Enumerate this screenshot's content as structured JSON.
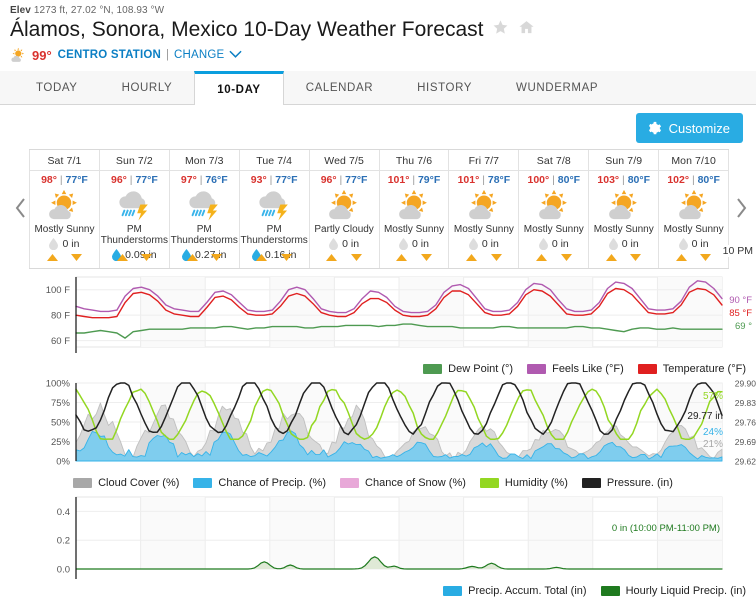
{
  "header": {
    "elev_prefix": "Elev",
    "elev_value": "1273 ft, 27.02 °N, 108.93 °W",
    "title": "Álamos, Sonora, Mexico 10-Day Weather Forecast",
    "star_icon": "star-icon",
    "home_icon": "home-icon",
    "current_temp": "99°",
    "station": "CENTRO STATION",
    "pipe": "|",
    "change_label": "CHANGE",
    "chevron_icon": "chevron-down-icon",
    "condition_icon": "partly-sunny-icon"
  },
  "tabs": [
    {
      "label": "TODAY",
      "active": false
    },
    {
      "label": "HOURLY",
      "active": false
    },
    {
      "label": "10-DAY",
      "active": true
    },
    {
      "label": "CALENDAR",
      "active": false
    },
    {
      "label": "HISTORY",
      "active": false
    },
    {
      "label": "WUNDERMAP",
      "active": false
    }
  ],
  "toolbar": {
    "customize_label": "Customize",
    "gear_icon": "gear-icon"
  },
  "strip": {
    "prev_icon": "chevron-left-icon",
    "next_icon": "chevron-right-icon",
    "hover_time_label": "10 PM",
    "days": [
      {
        "name": "Sat 7/1",
        "hi": "98°",
        "bar": "|",
        "lo": "77°F",
        "icon": "mostly-sunny-icon",
        "desc": "Mostly Sunny",
        "precip": "0 in",
        "precip_icon": "drop-empty-icon"
      },
      {
        "name": "Sun 7/2",
        "hi": "96°",
        "bar": "|",
        "lo": "77°F",
        "icon": "thunderstorm-icon",
        "desc": "PM Thunderstorms",
        "precip": "0.09 in",
        "precip_icon": "drop-filled-icon"
      },
      {
        "name": "Mon 7/3",
        "hi": "97°",
        "bar": "|",
        "lo": "76°F",
        "icon": "thunderstorm-icon",
        "desc": "PM Thunderstorms",
        "precip": "0.27 in",
        "precip_icon": "drop-filled-icon"
      },
      {
        "name": "Tue 7/4",
        "hi": "93°",
        "bar": "|",
        "lo": "77°F",
        "icon": "thunderstorm-icon",
        "desc": "PM Thunderstorms",
        "precip": "0.16 in",
        "precip_icon": "drop-filled-icon"
      },
      {
        "name": "Wed 7/5",
        "hi": "96°",
        "bar": "|",
        "lo": "77°F",
        "icon": "partly-cloudy-icon",
        "desc": "Partly Cloudy",
        "precip": "0 in",
        "precip_icon": "drop-empty-icon"
      },
      {
        "name": "Thu 7/6",
        "hi": "101°",
        "bar": "|",
        "lo": "79°F",
        "icon": "mostly-sunny-icon",
        "desc": "Mostly Sunny",
        "precip": "0 in",
        "precip_icon": "drop-empty-icon"
      },
      {
        "name": "Fri 7/7",
        "hi": "101°",
        "bar": "|",
        "lo": "78°F",
        "icon": "mostly-sunny-icon",
        "desc": "Mostly Sunny",
        "precip": "0 in",
        "precip_icon": "drop-empty-icon"
      },
      {
        "name": "Sat 7/8",
        "hi": "100°",
        "bar": "|",
        "lo": "80°F",
        "icon": "mostly-sunny-icon",
        "desc": "Mostly Sunny",
        "precip": "0 in",
        "precip_icon": "drop-empty-icon"
      },
      {
        "name": "Sun 7/9",
        "hi": "103°",
        "bar": "|",
        "lo": "80°F",
        "icon": "mostly-sunny-icon",
        "desc": "Mostly Sunny",
        "precip": "0 in",
        "precip_icon": "drop-empty-icon"
      },
      {
        "name": "Mon 7/10",
        "hi": "102°",
        "bar": "|",
        "lo": "80°F",
        "icon": "mostly-sunny-icon",
        "desc": "Mostly Sunny",
        "precip": "0 in",
        "precip_icon": "drop-empty-icon"
      }
    ]
  },
  "colors": {
    "accent": "#29ace3",
    "link": "#0b7fc4",
    "high": "#d9322e",
    "low": "#2b6fb5",
    "dew_point": "#4e9a51",
    "feels_like": "#b05ab0",
    "temperature": "#e02020",
    "cloud_cover": "#a8a8a8",
    "chance_precip": "#36b3e8",
    "chance_snow": "#e8a8d8",
    "humidity": "#93d722",
    "pressure": "#222222",
    "precip_accum": "#29ace3",
    "hourly_precip": "#1f7a1f"
  },
  "chart_data": [
    {
      "type": "line",
      "name": "temperature-chart",
      "title": "",
      "xlabel": "",
      "ylabel": "",
      "ylim": [
        55,
        110
      ],
      "yticks": [
        "60 F",
        "80 F",
        "100 F"
      ],
      "ytick_values": [
        60,
        80,
        100
      ],
      "grid": true,
      "x_days": [
        "Sat 7/1",
        "Sun 7/2",
        "Mon 7/3",
        "Tue 7/4",
        "Wed 7/5",
        "Thu 7/6",
        "Fri 7/7",
        "Sat 7/8",
        "Sun 7/9",
        "Mon 7/10"
      ],
      "end_labels": [
        {
          "text": "90 °F",
          "series": "Feels Like (°F)",
          "color": "#b05ab0"
        },
        {
          "text": "85 °F",
          "series": "Temperature (°F)",
          "color": "#e02020"
        },
        {
          "text": "69 °",
          "series": "Dew Point (°)",
          "color": "#4e9a51"
        }
      ],
      "legend_position": "bottom-right",
      "series": [
        {
          "name": "Dew Point (°)",
          "color": "#4e9a51",
          "values": [
            66,
            66,
            67,
            68,
            67,
            66,
            62,
            67,
            68,
            69,
            69,
            69,
            69,
            69,
            70,
            70,
            70,
            70,
            71,
            71,
            70,
            69,
            70,
            70,
            71,
            71,
            71,
            71,
            70,
            70,
            71,
            71,
            71,
            72,
            72,
            72,
            72,
            71,
            72,
            72,
            73,
            73,
            72,
            71,
            71,
            71,
            71,
            70,
            70,
            70,
            70,
            70,
            71,
            71,
            70,
            70,
            70,
            70,
            70,
            70,
            70,
            71,
            71,
            70,
            70,
            69,
            68,
            67,
            69,
            70,
            70,
            69,
            69,
            70,
            69,
            69,
            69,
            69,
            69,
            69
          ]
        },
        {
          "name": "Feels Like (°F)",
          "color": "#b05ab0",
          "values": [
            87,
            85,
            84,
            83,
            83,
            84,
            95,
            101,
            102,
            100,
            95,
            88,
            85,
            84,
            83,
            83,
            90,
            98,
            99,
            96,
            90,
            84,
            83,
            83,
            84,
            91,
            100,
            102,
            100,
            93,
            85,
            83,
            82,
            82,
            85,
            93,
            99,
            98,
            94,
            87,
            83,
            82,
            82,
            83,
            88,
            98,
            103,
            104,
            101,
            93,
            85,
            83,
            83,
            84,
            90,
            100,
            105,
            104,
            100,
            92,
            85,
            83,
            83,
            84,
            90,
            101,
            106,
            105,
            101,
            93,
            85,
            84,
            84,
            85,
            91,
            102,
            107,
            106,
            101,
            93
          ]
        },
        {
          "name": "Temperature (°F)",
          "color": "#e02020",
          "values": [
            80,
            79,
            78,
            78,
            78,
            79,
            90,
            97,
            98,
            96,
            91,
            84,
            81,
            80,
            79,
            79,
            86,
            94,
            95,
            92,
            86,
            81,
            80,
            80,
            81,
            87,
            95,
            97,
            95,
            89,
            82,
            80,
            79,
            79,
            82,
            89,
            93,
            93,
            90,
            84,
            80,
            79,
            79,
            80,
            85,
            94,
            99,
            99,
            96,
            89,
            82,
            80,
            80,
            81,
            87,
            96,
            100,
            99,
            95,
            88,
            81,
            80,
            80,
            81,
            87,
            97,
            101,
            100,
            96,
            89,
            82,
            81,
            81,
            82,
            88,
            98,
            101,
            100,
            96,
            88
          ]
        }
      ]
    },
    {
      "type": "area",
      "name": "conditions-chart",
      "title": "",
      "xlabel": "",
      "ylabel": "",
      "ylim": [
        0,
        100
      ],
      "yticks": [
        "0%",
        "25%",
        "50%",
        "75%",
        "100%"
      ],
      "ytick_values": [
        0,
        25,
        50,
        75,
        100
      ],
      "y2ticks": [
        "29.62",
        "29.69",
        "29.76",
        "29.83",
        "29.90"
      ],
      "y2lim": [
        29.62,
        29.9
      ],
      "grid": true,
      "end_labels": [
        {
          "text": "57%",
          "series": "Humidity (%)",
          "color": "#93d722"
        },
        {
          "text": "29.77 in",
          "series": "Pressure. (in)",
          "color": "#222222"
        },
        {
          "text": "24%",
          "series": "Chance of Precip. (%)",
          "color": "#36b3e8"
        },
        {
          "text": "21%",
          "series": "Cloud Cover (%)",
          "color": "#a8a8a8"
        }
      ],
      "legend_position": "bottom-center",
      "series": [
        {
          "name": "Cloud Cover (%)",
          "color": "#a8a8a8",
          "kind": "area"
        },
        {
          "name": "Chance of Precip. (%)",
          "color": "#36b3e8",
          "kind": "area"
        },
        {
          "name": "Chance of Snow (%)",
          "color": "#e8a8d8",
          "kind": "area"
        },
        {
          "name": "Humidity (%)",
          "color": "#93d722",
          "kind": "line"
        },
        {
          "name": "Pressure. (in)",
          "color": "#222222",
          "kind": "line"
        }
      ]
    },
    {
      "type": "area",
      "name": "precipitation-chart",
      "title": "",
      "xlabel": "",
      "ylabel": "",
      "ylim": [
        0,
        0.5
      ],
      "yticks": [
        "0.0",
        "0.2",
        "0.4"
      ],
      "ytick_values": [
        0.0,
        0.2,
        0.4
      ],
      "grid": true,
      "annotation": "0 in (10:00 PM-11:00 PM)",
      "annotation_color": "#1f7a1f",
      "legend_position": "bottom-right",
      "series": [
        {
          "name": "Precip. Accum. Total (in)",
          "color": "#29ace3",
          "kind": "line"
        },
        {
          "name": "Hourly Liquid Precip. (in)",
          "color": "#1f7a1f",
          "kind": "area"
        }
      ]
    }
  ]
}
